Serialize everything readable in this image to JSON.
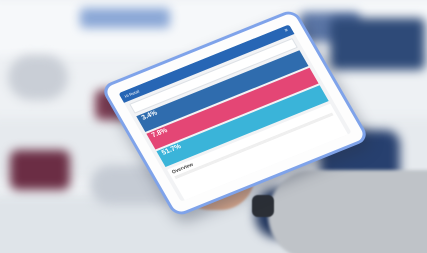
{
  "tablet_app": {
    "appbar_title": "Hi Retail",
    "menu_glyph": "≡",
    "search_placeholder": "",
    "kpis": [
      {
        "value": "3.4%",
        "label": ""
      },
      {
        "value": "7.8%",
        "label": ""
      },
      {
        "value": "51.7%",
        "label": ""
      }
    ],
    "overview_title": "Overview"
  }
}
